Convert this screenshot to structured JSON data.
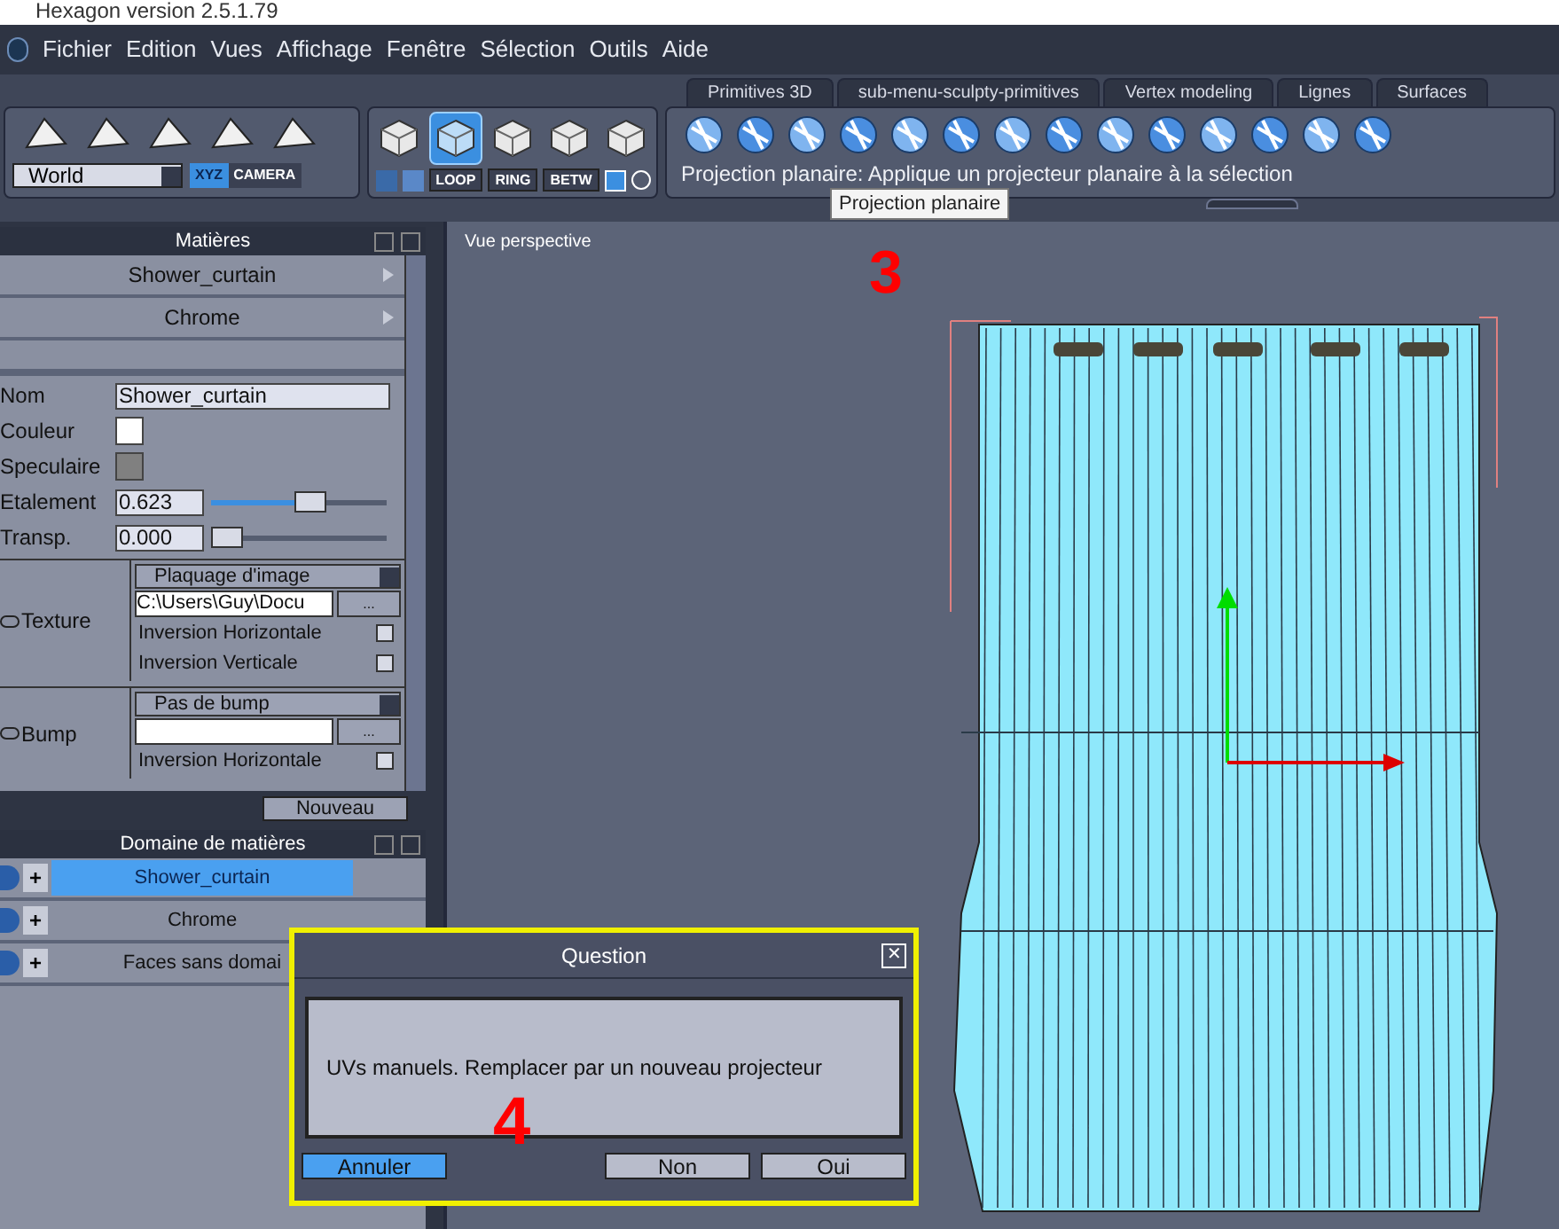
{
  "window": {
    "title": "Hexagon version 2.5.1.79"
  },
  "menu": [
    "Fichier",
    "Edition",
    "Vues",
    "Affichage",
    "Fenêtre",
    "Sélection",
    "Outils",
    "Aide"
  ],
  "toolbar": {
    "space_select": "World",
    "space_toggle": [
      {
        "label": "XYZ",
        "selected": true
      },
      {
        "label": "CAMERA",
        "selected": false
      }
    ],
    "select_modes": [
      {
        "selected": false
      },
      {
        "selected": true
      },
      {
        "selected": false
      },
      {
        "selected": false
      },
      {
        "selected": false
      }
    ],
    "edge_buttons": [
      "LOOP",
      "RING",
      "BETW"
    ],
    "tabs": [
      {
        "label": "Primitives 3D",
        "selected": false
      },
      {
        "label": "sub-menu-sculpty-primitives",
        "selected": false
      },
      {
        "label": "Vertex modeling",
        "selected": false
      },
      {
        "label": "Lignes",
        "selected": false
      },
      {
        "label": "Surfaces",
        "selected": false
      }
    ],
    "status_text": "Projection planaire: Applique un projecteur planaire à la sélection",
    "tooltip": "Projection planaire"
  },
  "materials_panel": {
    "title": "Matières",
    "list": [
      {
        "name": "Shower_curtain"
      },
      {
        "name": "Chrome"
      }
    ],
    "name_label": "Nom",
    "name_value": "Shower_curtain",
    "swatches": [
      {
        "label": "Couleur",
        "color": "#ffffff"
      },
      {
        "label": "Speculaire",
        "color": "#808080"
      }
    ],
    "spread": {
      "label": "Etalement",
      "value": "0.623",
      "level": 0.58
    },
    "transp": {
      "label": "Transp.",
      "value": "0.000",
      "level": 0
    },
    "texture": {
      "label": "Texture",
      "mapping": "Plaquage d'image",
      "path": "C:\\Users\\Guy\\Docu",
      "browse": "...",
      "flips": [
        {
          "label": "Inversion Horizontale",
          "checked": false
        },
        {
          "label": "Inversion Verticale",
          "checked": false
        }
      ]
    },
    "bump": {
      "label": "Bump",
      "mapping": "Pas de bump",
      "browse": "...",
      "flips": [
        {
          "label": "Inversion Horizontale",
          "checked": false
        }
      ]
    },
    "new_button": "Nouveau"
  },
  "domain_panel": {
    "title": "Domaine de matières",
    "items": [
      {
        "add": "+",
        "name": "Shower_curtain",
        "selected": true
      },
      {
        "add": "+",
        "name": "Chrome",
        "selected": false
      },
      {
        "add": "+",
        "name": "Faces sans domai",
        "selected": false
      }
    ]
  },
  "viewport": {
    "label": "Vue perspective",
    "annotation": "3"
  },
  "dialog": {
    "title": "Question",
    "close": "✕",
    "message": "UVs manuels. Remplacer par un nouveau projecteur",
    "annotation": "4",
    "buttons": [
      {
        "label": "Annuler",
        "selected": true
      },
      {
        "label": "Non",
        "selected": false
      },
      {
        "label": "Oui",
        "selected": false
      }
    ]
  }
}
